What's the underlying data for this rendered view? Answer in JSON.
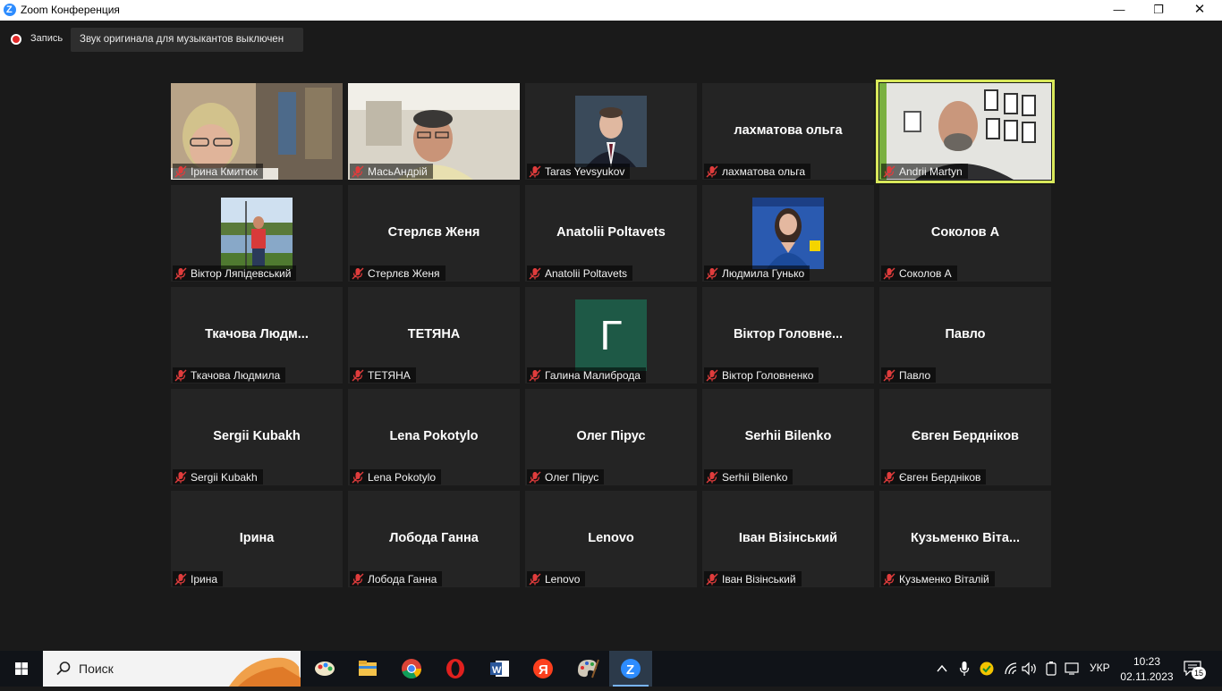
{
  "window": {
    "title": "Zoom Конференция",
    "minimize": "—",
    "maximize": "❐",
    "close": "✕"
  },
  "toolbar": {
    "record_label": "Запись",
    "original_sound_label": "Звук оригинала для музыкантов выключен"
  },
  "participants": [
    {
      "label": "Ірина Кмитюк",
      "center": "",
      "kind": "video-woman"
    },
    {
      "label": "МасьАндрій",
      "center": "",
      "kind": "video-man"
    },
    {
      "label": "Taras Yevsyukov",
      "center": "",
      "kind": "photo-suit"
    },
    {
      "label": "лахматова ольга",
      "center": "лахматова ольга",
      "kind": "name"
    },
    {
      "label": "Andrii Martyn",
      "center": "",
      "kind": "video-office",
      "active": true
    },
    {
      "label": "Віктор Ляпідевський",
      "center": "",
      "kind": "photo-outdoor"
    },
    {
      "label": "Стерлєв Женя",
      "center": "Стерлєв Женя",
      "kind": "name"
    },
    {
      "label": "Anatolii Poltavets",
      "center": "Anatolii Poltavets",
      "kind": "name"
    },
    {
      "label": "Людмила Гунько",
      "center": "",
      "kind": "photo-woman"
    },
    {
      "label": "Соколов А",
      "center": "Соколов А",
      "kind": "name"
    },
    {
      "label": "Ткачова Людмила",
      "center": "Ткачова  Людм...",
      "kind": "name"
    },
    {
      "label": "ТЕТЯНА",
      "center": "ТЕТЯНА",
      "kind": "name"
    },
    {
      "label": "Галина Малиброда",
      "center": "",
      "kind": "letter",
      "letter": "Г"
    },
    {
      "label": "Віктор Головненко",
      "center": "Віктор  Головне...",
      "kind": "name"
    },
    {
      "label": "Павло",
      "center": "Павло",
      "kind": "name"
    },
    {
      "label": "Sergii Kubakh",
      "center": "Sergii Kubakh",
      "kind": "name"
    },
    {
      "label": "Lena Pokotylo",
      "center": "Lena Pokotylo",
      "kind": "name"
    },
    {
      "label": "Олег Пірус",
      "center": "Олег Пірус",
      "kind": "name"
    },
    {
      "label": "Serhii Bilenko",
      "center": "Serhii Bilenko",
      "kind": "name"
    },
    {
      "label": "Євген Бердніков",
      "center": "Євген Бердніков",
      "kind": "name"
    },
    {
      "label": "Ірина",
      "center": "Ірина",
      "kind": "name"
    },
    {
      "label": "Лобода Ганна",
      "center": "Лобода Ганна",
      "kind": "name"
    },
    {
      "label": "Lenovo",
      "center": "Lenovo",
      "kind": "name"
    },
    {
      "label": "Іван Візінський",
      "center": "Іван Візінський",
      "kind": "name"
    },
    {
      "label": "Кузьменко Віталій",
      "center": "Кузьменко  Віта...",
      "kind": "name"
    }
  ],
  "taskbar": {
    "search_placeholder": "Поиск",
    "apps": [
      "paint-icon",
      "file-explorer-icon",
      "chrome-icon",
      "opera-icon",
      "word-icon",
      "yandex-icon",
      "palette-icon",
      "zoom-icon"
    ],
    "language": "УКР",
    "time": "10:23",
    "date": "02.11.2023",
    "notifications": "15"
  },
  "colors": {
    "background": "#1a1a1a",
    "tile": "#242424",
    "active_speaker": "#d9e95b",
    "muted": "#e03c3c",
    "zoom_blue": "#2d8cff",
    "avatar_green": "#1e5946"
  }
}
